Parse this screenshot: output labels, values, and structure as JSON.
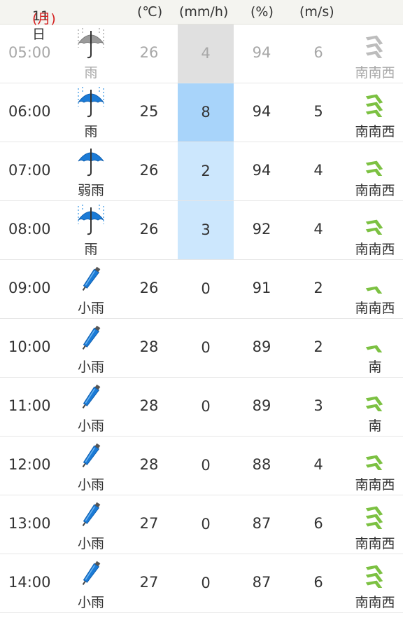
{
  "header": {
    "date": "11日",
    "day_of_week": "(月)",
    "temp_unit": "(℃)",
    "precip_unit": "(mm/h)",
    "humidity_unit": "(%)",
    "wind_unit": "(m/s)"
  },
  "colors": {
    "accent_red": "#d42020",
    "past_grey": "#a8a8a8",
    "wind_green": "#7cc142",
    "umbrella_blue": "#1b7bd6"
  },
  "rows": [
    {
      "time": "05:00",
      "weather": "雨",
      "icon": "umbrella-rain-icon",
      "temp": "26",
      "precip": "4",
      "humidity": "94",
      "wind_speed": "6",
      "wind_dir": "南南西",
      "chevrons": 3,
      "past": true
    },
    {
      "time": "06:00",
      "weather": "雨",
      "icon": "umbrella-rain-icon",
      "temp": "25",
      "precip": "8",
      "humidity": "94",
      "wind_speed": "5",
      "wind_dir": "南南西",
      "chevrons": 3
    },
    {
      "time": "07:00",
      "weather": "弱雨",
      "icon": "umbrella-icon",
      "temp": "26",
      "precip": "2",
      "humidity": "94",
      "wind_speed": "4",
      "wind_dir": "南南西",
      "chevrons": 2
    },
    {
      "time": "08:00",
      "weather": "雨",
      "icon": "umbrella-rain-icon",
      "temp": "26",
      "precip": "3",
      "humidity": "92",
      "wind_speed": "4",
      "wind_dir": "南南西",
      "chevrons": 2
    },
    {
      "time": "09:00",
      "weather": "小雨",
      "icon": "closed-umbrella-icon",
      "temp": "26",
      "precip": "0",
      "humidity": "91",
      "wind_speed": "2",
      "wind_dir": "南南西",
      "chevrons": 1
    },
    {
      "time": "10:00",
      "weather": "小雨",
      "icon": "closed-umbrella-icon",
      "temp": "28",
      "precip": "0",
      "humidity": "89",
      "wind_speed": "2",
      "wind_dir": "南",
      "chevrons": 1
    },
    {
      "time": "11:00",
      "weather": "小雨",
      "icon": "closed-umbrella-icon",
      "temp": "28",
      "precip": "0",
      "humidity": "89",
      "wind_speed": "3",
      "wind_dir": "南",
      "chevrons": 2
    },
    {
      "time": "12:00",
      "weather": "小雨",
      "icon": "closed-umbrella-icon",
      "temp": "28",
      "precip": "0",
      "humidity": "88",
      "wind_speed": "4",
      "wind_dir": "南南西",
      "chevrons": 2
    },
    {
      "time": "13:00",
      "weather": "小雨",
      "icon": "closed-umbrella-icon",
      "temp": "27",
      "precip": "0",
      "humidity": "87",
      "wind_speed": "6",
      "wind_dir": "南南西",
      "chevrons": 3
    },
    {
      "time": "14:00",
      "weather": "小雨",
      "icon": "closed-umbrella-icon",
      "temp": "27",
      "precip": "0",
      "humidity": "87",
      "wind_speed": "6",
      "wind_dir": "南南西",
      "chevrons": 3
    }
  ]
}
